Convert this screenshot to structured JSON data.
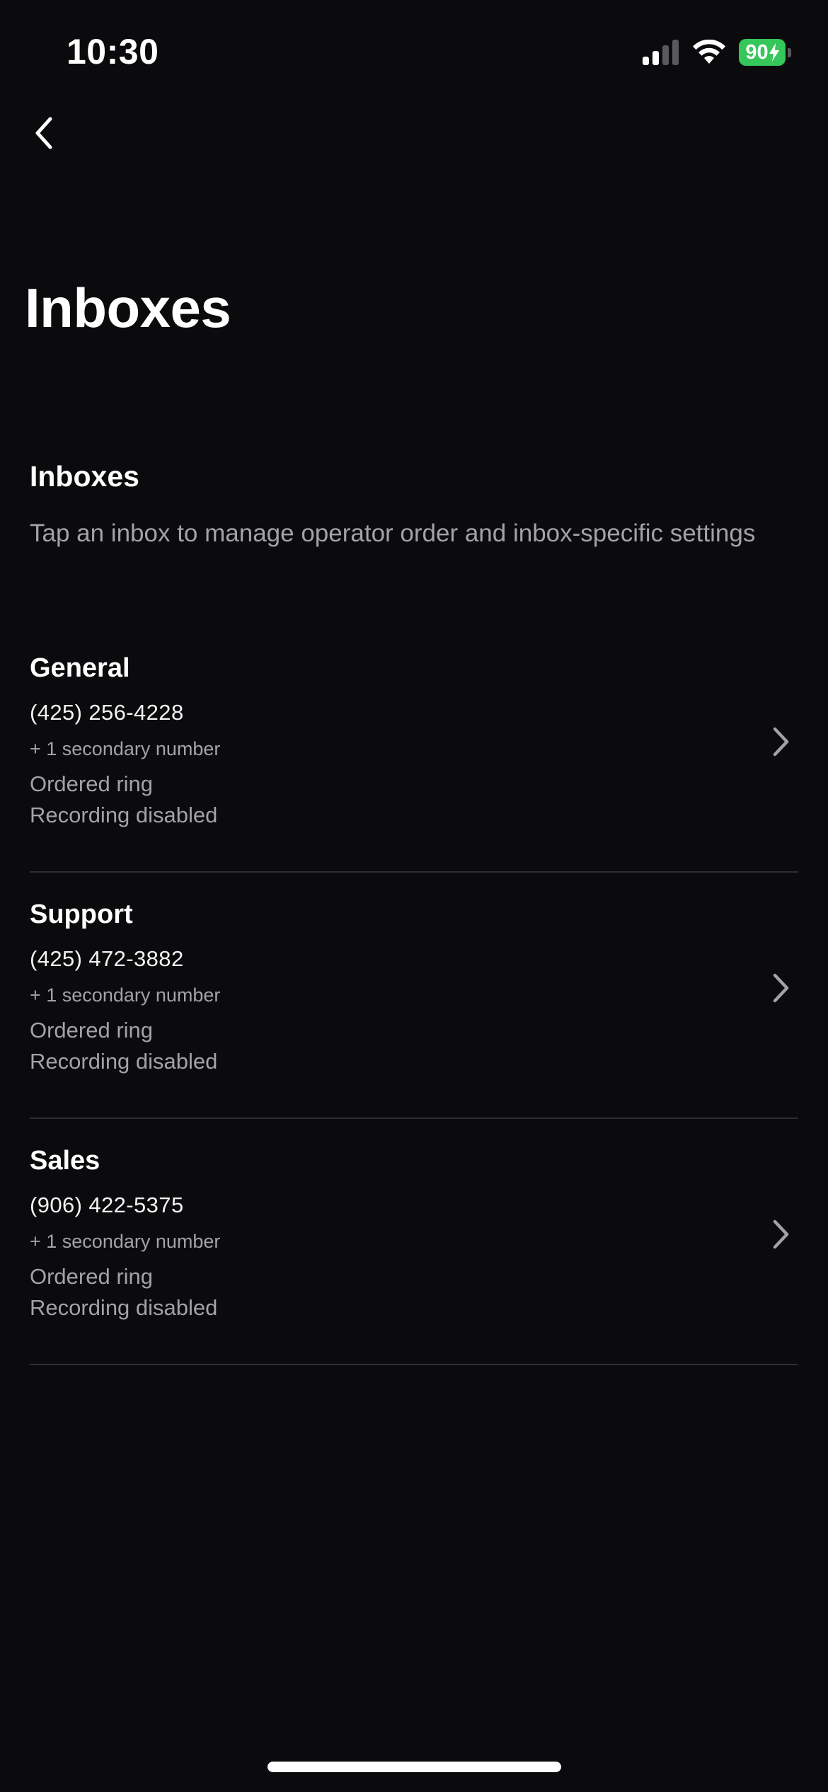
{
  "status_bar": {
    "time": "10:30",
    "battery_level": "90",
    "icons": [
      "signal-icon",
      "wifi-icon",
      "battery-charging-icon"
    ],
    "battery_color": "#35c759"
  },
  "nav": {
    "back_icon": "chevron-left-icon"
  },
  "page": {
    "title": "Inboxes"
  },
  "section": {
    "heading": "Inboxes",
    "description": "Tap an inbox to manage operator order and inbox-specific settings"
  },
  "inboxes": [
    {
      "name": "General",
      "phone": "(425) 256-4228",
      "secondary": "+ 1 secondary number",
      "ring": "Ordered ring",
      "recording": "Recording disabled"
    },
    {
      "name": "Support",
      "phone": "(425) 472-3882",
      "secondary": "+ 1 secondary number",
      "ring": "Ordered ring",
      "recording": "Recording disabled"
    },
    {
      "name": "Sales",
      "phone": "(906) 422-5375",
      "secondary": "+ 1 secondary number",
      "ring": "Ordered ring",
      "recording": "Recording disabled"
    }
  ],
  "colors": {
    "background": "#0b0b0d",
    "primary_text": "#ffffff",
    "secondary_text": "#a2a2a8",
    "divider": "#2e2e32"
  }
}
